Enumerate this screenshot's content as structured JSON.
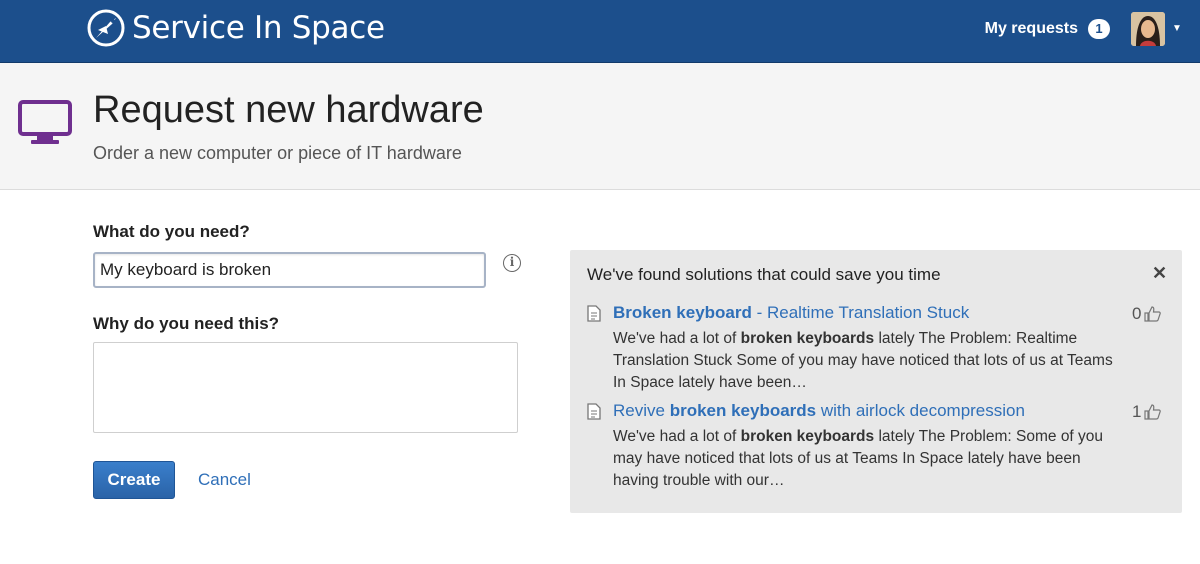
{
  "topbar": {
    "brand": "Service In Space",
    "my_requests_label": "My requests",
    "my_requests_count": "1"
  },
  "header": {
    "title": "Request new hardware",
    "subtitle": "Order a new computer or piece of IT hardware"
  },
  "form": {
    "need_label": "What do you need?",
    "need_value": "My keyboard is broken",
    "why_label": "Why do you need this?",
    "why_value": "",
    "create_label": "Create",
    "cancel_label": "Cancel"
  },
  "solutions": {
    "heading": "We've found solutions that could save you time",
    "items": [
      {
        "title_pre": "",
        "title_bold": "Broken keyboard",
        "title_post": " - Realtime Translation Stuck",
        "text_pre": "We've had a lot of ",
        "text_bold": "broken keyboards",
        "text_post": " lately The Problem: Realtime Translation Stuck Some of you may have noticed that lots of us at Teams In Space lately have been…",
        "votes": "0"
      },
      {
        "title_pre": "Revive ",
        "title_bold": "broken keyboards",
        "title_post": " with airlock decompression",
        "text_pre": "We've had a lot of ",
        "text_bold": "broken keyboards",
        "text_post": " lately The Problem: Some of you may have noticed that lots of us at Teams In Space lately have been having trouble with our…",
        "votes": "1"
      }
    ]
  },
  "colors": {
    "topbar": "#1c4f8c",
    "link": "#2f6fb8",
    "hardware_icon": "#6f2f8f"
  },
  "icons": {
    "brand": "rocket-logo-icon",
    "hardware": "monitor-icon",
    "info": "info-icon",
    "close": "close-icon",
    "doc": "document-icon",
    "thumb": "thumbs-up-icon"
  }
}
